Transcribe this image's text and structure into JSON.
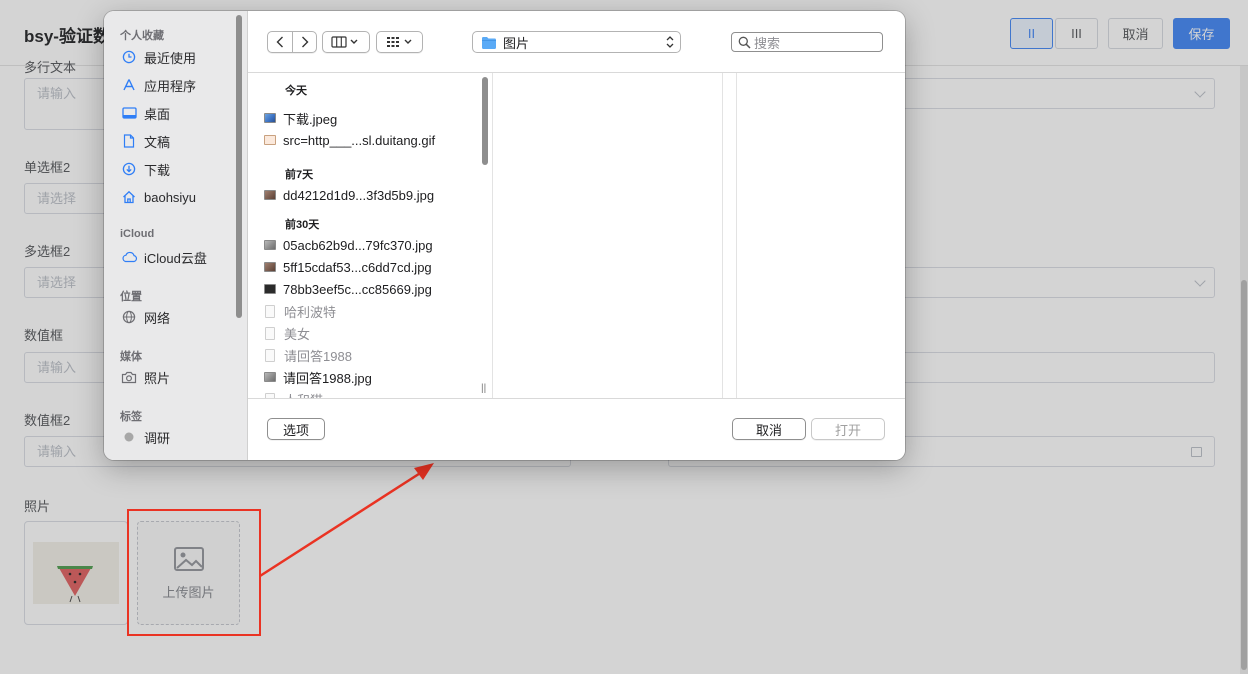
{
  "page": {
    "title": "bsy-验证数",
    "header_buttons": {
      "layout_two_col": "II",
      "layout_three_col": "III",
      "cancel": "取消",
      "save": "保存"
    },
    "fields": [
      {
        "label": "多行文本",
        "placeholder": "请输入"
      },
      {
        "label": "单选框2",
        "placeholder": "请选择"
      },
      {
        "label": "多选框2",
        "placeholder": "请选择"
      },
      {
        "label": "数值框",
        "placeholder": "请输入"
      },
      {
        "label": "数值框2",
        "placeholder": "请输入"
      }
    ],
    "photo": {
      "label": "照片",
      "upload_text": "上传图片"
    }
  },
  "dialog": {
    "sidebar": {
      "sections": [
        {
          "title": "个人收藏",
          "items": [
            {
              "label": "最近使用",
              "icon": "clock-icon"
            },
            {
              "label": "应用程序",
              "icon": "apps-icon"
            },
            {
              "label": "桌面",
              "icon": "desktop-icon"
            },
            {
              "label": "文稿",
              "icon": "document-icon"
            },
            {
              "label": "下载",
              "icon": "download-icon"
            },
            {
              "label": "baohsiyu",
              "icon": "home-icon"
            }
          ]
        },
        {
          "title": "iCloud",
          "items": [
            {
              "label": "iCloud云盘",
              "icon": "cloud-icon"
            }
          ]
        },
        {
          "title": "位置",
          "items": [
            {
              "label": "网络",
              "icon": "globe-icon"
            }
          ]
        },
        {
          "title": "媒体",
          "items": [
            {
              "label": "照片",
              "icon": "camera-icon"
            }
          ]
        },
        {
          "title": "标签",
          "items": [
            {
              "label": "调研",
              "icon": "tag-dot-icon",
              "color": "#a7a7a7"
            }
          ]
        }
      ]
    },
    "toolbar": {
      "location": "图片",
      "search_placeholder": "搜索"
    },
    "file_list": {
      "groups": [
        {
          "title": "今天",
          "files": [
            {
              "name": "下载.jpeg",
              "kind": "image"
            },
            {
              "name": "src=http___...sl.duitang.gif",
              "kind": "gif"
            }
          ]
        },
        {
          "title": "前7天",
          "files": [
            {
              "name": "dd4212d1d9...3f3d5b9.jpg",
              "kind": "image"
            }
          ]
        },
        {
          "title": "前30天",
          "files": [
            {
              "name": "05acb62b9d...79fc370.jpg",
              "kind": "image"
            },
            {
              "name": "5ff15cdaf53...c6dd7cd.jpg",
              "kind": "image"
            },
            {
              "name": "78bb3eef5c...cc85669.jpg",
              "kind": "image"
            },
            {
              "name": "哈利波特",
              "kind": "folder-dim"
            },
            {
              "name": "美女",
              "kind": "folder-dim"
            },
            {
              "name": "请回答1988",
              "kind": "folder-dim"
            },
            {
              "name": "请回答1988.jpg",
              "kind": "image"
            },
            {
              "name": "人和猫",
              "kind": "folder-dim"
            }
          ]
        }
      ]
    },
    "footer": {
      "options": "选项",
      "cancel": "取消",
      "open": "打开"
    }
  },
  "annotation": {
    "color": "#ea3323"
  }
}
